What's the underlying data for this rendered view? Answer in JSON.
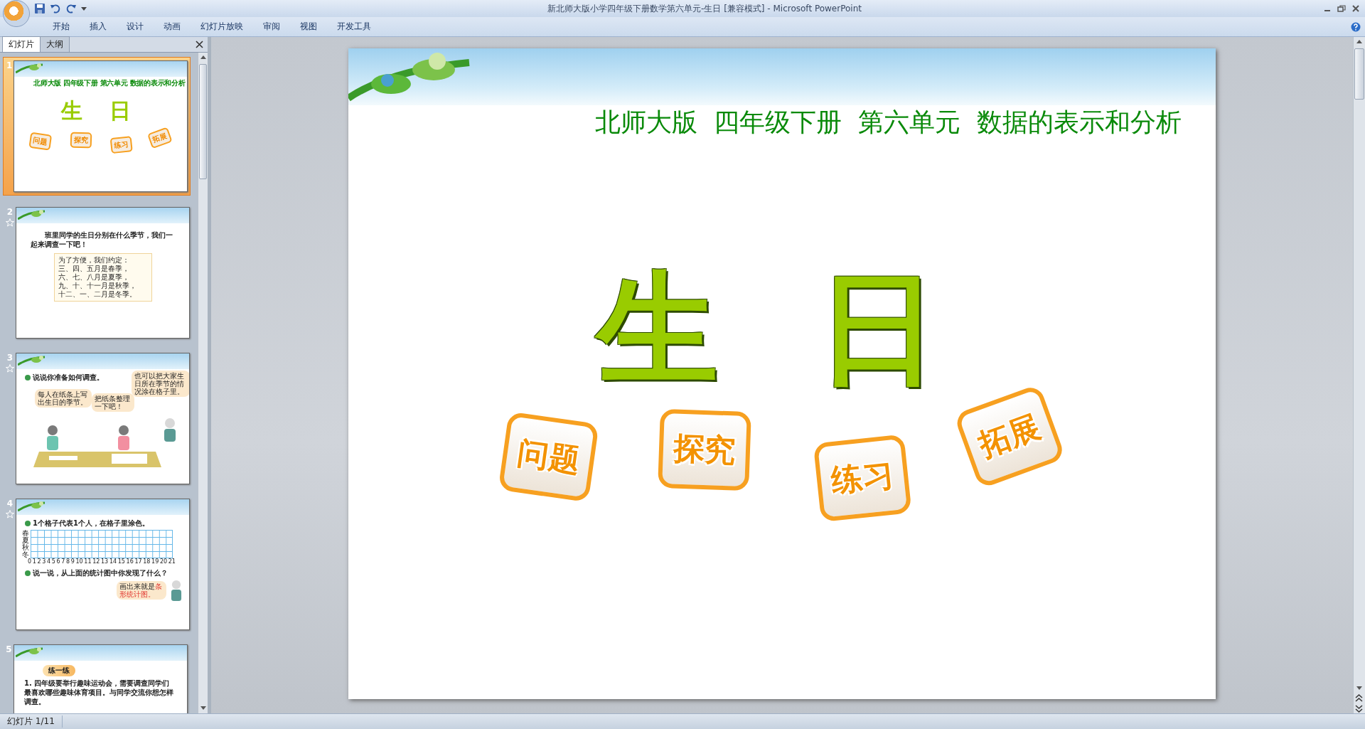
{
  "window": {
    "title": "新北师大版小学四年级下册数学第六单元-生日 [兼容模式] - Microsoft PowerPoint"
  },
  "ribbon_tabs": [
    "开始",
    "插入",
    "设计",
    "动画",
    "幻灯片放映",
    "审阅",
    "视图",
    "开发工具"
  ],
  "panel_tabs": [
    {
      "label": "幻灯片",
      "selected": true
    },
    {
      "label": "大纲",
      "selected": false
    }
  ],
  "slides": [
    {
      "number": "1",
      "selected": true,
      "animated": false,
      "kind": "title",
      "header": "北师大版  四年级下册  第六单元  数据的表示和分析",
      "title": "生 日",
      "badges": [
        "问题",
        "探究",
        "练习",
        "拓展"
      ]
    },
    {
      "number": "2",
      "selected": false,
      "animated": true,
      "kind": "note",
      "question": "班里同学的生日分别在什么季节，我们一起来调查一下吧！",
      "note_lines": [
        "为了方便，我们约定：",
        "三、四、五月是春季，",
        "六、七、八月是夏季，",
        "九、十、十一月是秋季，",
        "十二、一、二月是冬季。"
      ]
    },
    {
      "number": "3",
      "selected": false,
      "animated": true,
      "kind": "scene",
      "heading": "说说你准备如何调查。",
      "bubbles": [
        "每人在纸条上写出生日的季节。",
        "把纸条整理一下吧！",
        "也可以把大家生日所在季节的情况涂在格子里。"
      ]
    },
    {
      "number": "4",
      "selected": false,
      "animated": true,
      "kind": "grid",
      "heading": "1个格子代表1个人，在格子里涂色。",
      "row_labels": [
        "春",
        "夏",
        "秋",
        "冬"
      ],
      "axis_numbers": [
        "0",
        "1",
        "2",
        "3",
        "4",
        "5",
        "6",
        "7",
        "8",
        "9",
        "10",
        "11",
        "12",
        "13",
        "14",
        "15",
        "16",
        "17",
        "18",
        "19",
        "20",
        "21"
      ],
      "question": "说一说，从上面的统计图中你发现了什么？",
      "bubble_text": "画出来就是",
      "bubble_highlight": "条形统计图。"
    },
    {
      "number": "5",
      "selected": false,
      "animated": false,
      "kind": "exercise",
      "badge": "练一练",
      "text": "1. 四年级要举行趣味运动会，需要调查同学们最喜欢哪些趣味体育项目。与同学交流你想怎样调查。"
    }
  ],
  "main_slide": {
    "header": "北师大版  四年级下册  第六单元  数据的表示和分析",
    "title": "生 日",
    "badges": [
      "问题",
      "探究",
      "练习",
      "拓展"
    ]
  },
  "status_bar": {
    "slide_counter": "幻灯片 1/11"
  }
}
